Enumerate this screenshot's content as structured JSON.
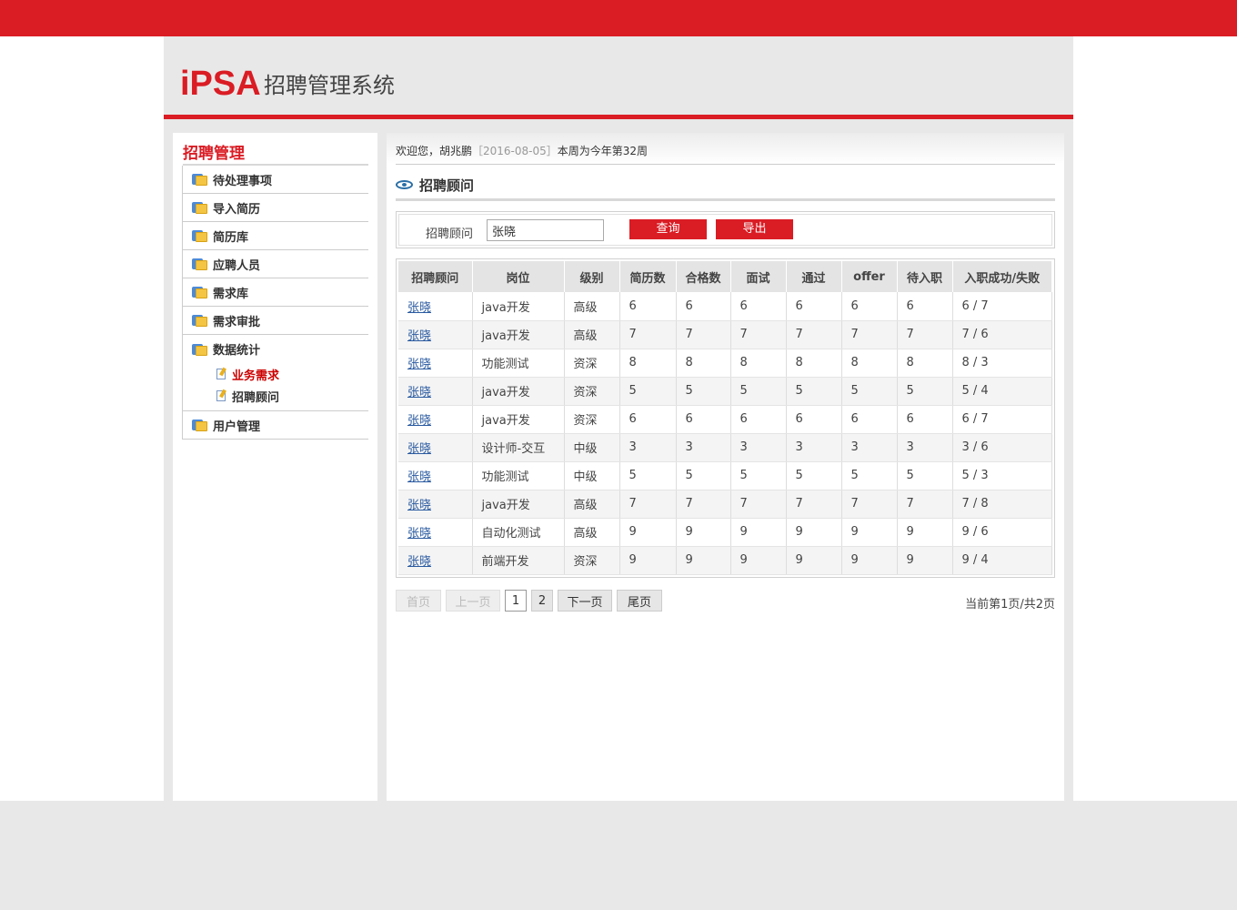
{
  "header": {
    "logo": "iPSA",
    "system_name": "招聘管理系统"
  },
  "sidebar": {
    "title": "招聘管理",
    "items": [
      {
        "label": "待处理事项"
      },
      {
        "label": "导入简历"
      },
      {
        "label": "简历库"
      },
      {
        "label": "应聘人员"
      },
      {
        "label": "需求库"
      },
      {
        "label": "需求审批"
      }
    ],
    "group": {
      "label": "数据统计",
      "children": [
        {
          "label": "业务需求",
          "active": true
        },
        {
          "label": "招聘顾问",
          "active": false
        }
      ]
    },
    "last_item": {
      "label": "用户管理"
    }
  },
  "welcome": {
    "greeting": "欢迎您，胡兆鹏",
    "date": "［2016-08-05］",
    "week": "本周为今年第32周"
  },
  "page": {
    "title": "招聘顾问"
  },
  "search": {
    "label": "招聘顾问",
    "value": "张晓",
    "query_btn": "查询",
    "export_btn": "导出"
  },
  "table": {
    "headers": [
      "招聘顾问",
      "岗位",
      "级别",
      "简历数",
      "合格数",
      "面试",
      "通过",
      "offer",
      "待入职",
      "入职成功/失败"
    ],
    "rows": [
      [
        "张晓",
        "java开发",
        "高级",
        "6",
        "6",
        "6",
        "6",
        "6",
        "6",
        "6 / 7"
      ],
      [
        "张晓",
        "java开发",
        "高级",
        "7",
        "7",
        "7",
        "7",
        "7",
        "7",
        "7 / 6"
      ],
      [
        "张晓",
        "功能测试",
        "资深",
        "8",
        "8",
        "8",
        "8",
        "8",
        "8",
        "8 / 3"
      ],
      [
        "张晓",
        "java开发",
        "资深",
        "5",
        "5",
        "5",
        "5",
        "5",
        "5",
        "5 / 4"
      ],
      [
        "张晓",
        "java开发",
        "资深",
        "6",
        "6",
        "6",
        "6",
        "6",
        "6",
        "6 / 7"
      ],
      [
        "张晓",
        "设计师-交互",
        "中级",
        "3",
        "3",
        "3",
        "3",
        "3",
        "3",
        "3 / 6"
      ],
      [
        "张晓",
        "功能测试",
        "中级",
        "5",
        "5",
        "5",
        "5",
        "5",
        "5",
        "5 / 3"
      ],
      [
        "张晓",
        "java开发",
        "高级",
        "7",
        "7",
        "7",
        "7",
        "7",
        "7",
        "7 / 8"
      ],
      [
        "张晓",
        "自动化测试",
        "高级",
        "9",
        "9",
        "9",
        "9",
        "9",
        "9",
        "9 / 6"
      ],
      [
        "张晓",
        "前端开发",
        "资深",
        "9",
        "9",
        "9",
        "9",
        "9",
        "9",
        "9 / 4"
      ]
    ]
  },
  "pager": {
    "first": "首页",
    "prev": "上一页",
    "pages": [
      "1",
      "2"
    ],
    "current": "1",
    "next": "下一页",
    "last": "尾页",
    "info": "当前第1页/共2页"
  },
  "colors": {
    "brand_red": "#da1c24",
    "link_blue": "#2a5aa0",
    "active_red": "#cc0000"
  }
}
